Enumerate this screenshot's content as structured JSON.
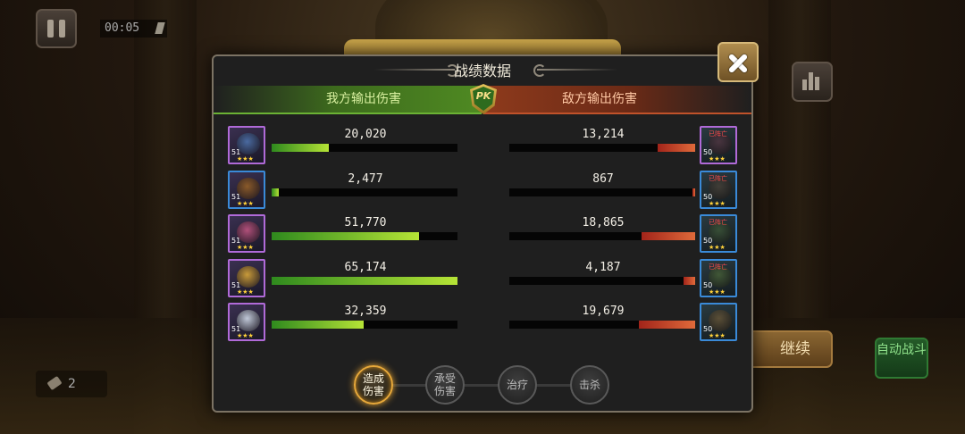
{
  "hud": {
    "timer": "00:05",
    "ticket_count": "2",
    "continue_label": "继续",
    "auto_battle_label": "自动战斗"
  },
  "dialog": {
    "title": "战绩数据",
    "ally_header": "我方输出伤害",
    "enemy_header": "敌方输出伤害",
    "pk_badge": "PK"
  },
  "rows": [
    {
      "ally_value": "20,020",
      "ally_fill": 0.307,
      "ally_level": "51",
      "ally_stars": "★★★",
      "enemy_value": "13,214",
      "enemy_fill": 0.203,
      "enemy_level": "50",
      "enemy_stars": "★★★",
      "enemy_status": "已阵亡"
    },
    {
      "ally_value": "2,477",
      "ally_fill": 0.038,
      "ally_level": "51",
      "ally_stars": "★★★",
      "enemy_value": "867",
      "enemy_fill": 0.013,
      "enemy_level": "50",
      "enemy_stars": "★★★",
      "enemy_status": "已阵亡"
    },
    {
      "ally_value": "51,770",
      "ally_fill": 0.794,
      "ally_level": "51",
      "ally_stars": "★★★",
      "enemy_value": "18,865",
      "enemy_fill": 0.289,
      "enemy_level": "50",
      "enemy_stars": "★★★",
      "enemy_status": "已阵亡"
    },
    {
      "ally_value": "65,174",
      "ally_fill": 1.0,
      "ally_level": "51",
      "ally_stars": "★★★",
      "enemy_value": "4,187",
      "enemy_fill": 0.064,
      "enemy_level": "50",
      "enemy_stars": "★★★",
      "enemy_status": "已阵亡"
    },
    {
      "ally_value": "32,359",
      "ally_fill": 0.496,
      "ally_level": "51",
      "ally_stars": "★★★",
      "enemy_value": "19,679",
      "enemy_fill": 0.302,
      "enemy_level": "50",
      "enemy_stars": "★★★",
      "enemy_status": ""
    }
  ],
  "tabs": [
    {
      "label": "造成伤害",
      "active": true
    },
    {
      "label": "承受伤害",
      "active": false
    },
    {
      "label": "治疗",
      "active": false
    },
    {
      "label": "击杀",
      "active": false
    }
  ],
  "colors": {
    "ally_bar": "#b6e436",
    "enemy_bar": "#e06a3a",
    "active_tab": "#e7a83a",
    "ally_frame": "#b06ad8",
    "enemy_frame_blue": "#3a8ad8"
  }
}
